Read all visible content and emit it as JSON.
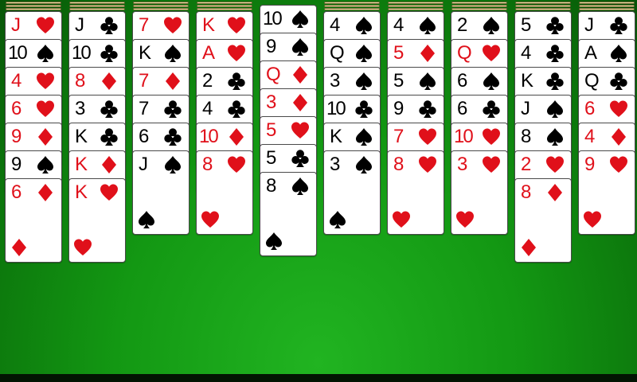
{
  "game": "Spider Solitaire",
  "colors": {
    "felt": "#139813",
    "red": "#e0101a",
    "black": "#000000",
    "stock_edge": "#f3e6a6"
  },
  "columns": [
    {
      "stock_layers": 3,
      "cards": [
        {
          "rank": "J",
          "suit": "heart"
        },
        {
          "rank": "10",
          "suit": "spade"
        },
        {
          "rank": "4",
          "suit": "heart"
        },
        {
          "rank": "6",
          "suit": "heart"
        },
        {
          "rank": "9",
          "suit": "diamond"
        },
        {
          "rank": "9",
          "suit": "spade"
        },
        {
          "rank": "6",
          "suit": "diamond"
        }
      ]
    },
    {
      "stock_layers": 3,
      "cards": [
        {
          "rank": "J",
          "suit": "club"
        },
        {
          "rank": "10",
          "suit": "club"
        },
        {
          "rank": "8",
          "suit": "diamond"
        },
        {
          "rank": "3",
          "suit": "club"
        },
        {
          "rank": "K",
          "suit": "club"
        },
        {
          "rank": "K",
          "suit": "diamond"
        },
        {
          "rank": "K",
          "suit": "heart"
        }
      ]
    },
    {
      "stock_layers": 3,
      "cards": [
        {
          "rank": "7",
          "suit": "heart"
        },
        {
          "rank": "K",
          "suit": "spade"
        },
        {
          "rank": "7",
          "suit": "diamond"
        },
        {
          "rank": "7",
          "suit": "club"
        },
        {
          "rank": "6",
          "suit": "club"
        },
        {
          "rank": "J",
          "suit": "spade"
        }
      ]
    },
    {
      "stock_layers": 3,
      "cards": [
        {
          "rank": "K",
          "suit": "heart"
        },
        {
          "rank": "A",
          "suit": "heart"
        },
        {
          "rank": "2",
          "suit": "club"
        },
        {
          "rank": "4",
          "suit": "club"
        },
        {
          "rank": "10",
          "suit": "diamond"
        },
        {
          "rank": "8",
          "suit": "heart"
        }
      ]
    },
    {
      "stock_layers": 0,
      "cards": [
        {
          "rank": "10",
          "suit": "spade"
        },
        {
          "rank": "9",
          "suit": "spade"
        },
        {
          "rank": "Q",
          "suit": "diamond"
        },
        {
          "rank": "3",
          "suit": "diamond"
        },
        {
          "rank": "5",
          "suit": "heart"
        },
        {
          "rank": "5",
          "suit": "club"
        },
        {
          "rank": "8",
          "suit": "spade"
        }
      ]
    },
    {
      "stock_layers": 3,
      "cards": [
        {
          "rank": "4",
          "suit": "spade"
        },
        {
          "rank": "Q",
          "suit": "spade"
        },
        {
          "rank": "3",
          "suit": "spade"
        },
        {
          "rank": "10",
          "suit": "club"
        },
        {
          "rank": "K",
          "suit": "spade"
        },
        {
          "rank": "3",
          "suit": "spade"
        }
      ]
    },
    {
      "stock_layers": 3,
      "cards": [
        {
          "rank": "4",
          "suit": "spade"
        },
        {
          "rank": "5",
          "suit": "diamond"
        },
        {
          "rank": "5",
          "suit": "spade"
        },
        {
          "rank": "9",
          "suit": "club"
        },
        {
          "rank": "7",
          "suit": "heart"
        },
        {
          "rank": "8",
          "suit": "heart"
        }
      ]
    },
    {
      "stock_layers": 3,
      "cards": [
        {
          "rank": "2",
          "suit": "spade"
        },
        {
          "rank": "Q",
          "suit": "heart"
        },
        {
          "rank": "6",
          "suit": "spade"
        },
        {
          "rank": "6",
          "suit": "club"
        },
        {
          "rank": "10",
          "suit": "heart"
        },
        {
          "rank": "3",
          "suit": "heart"
        }
      ]
    },
    {
      "stock_layers": 3,
      "cards": [
        {
          "rank": "5",
          "suit": "club"
        },
        {
          "rank": "4",
          "suit": "club"
        },
        {
          "rank": "K",
          "suit": "club"
        },
        {
          "rank": "J",
          "suit": "spade"
        },
        {
          "rank": "8",
          "suit": "spade"
        },
        {
          "rank": "2",
          "suit": "heart"
        },
        {
          "rank": "8",
          "suit": "diamond"
        }
      ]
    },
    {
      "stock_layers": 3,
      "cards": [
        {
          "rank": "J",
          "suit": "club"
        },
        {
          "rank": "A",
          "suit": "spade"
        },
        {
          "rank": "Q",
          "suit": "club"
        },
        {
          "rank": "6",
          "suit": "heart"
        },
        {
          "rank": "4",
          "suit": "diamond"
        },
        {
          "rank": "9",
          "suit": "heart"
        }
      ]
    }
  ]
}
